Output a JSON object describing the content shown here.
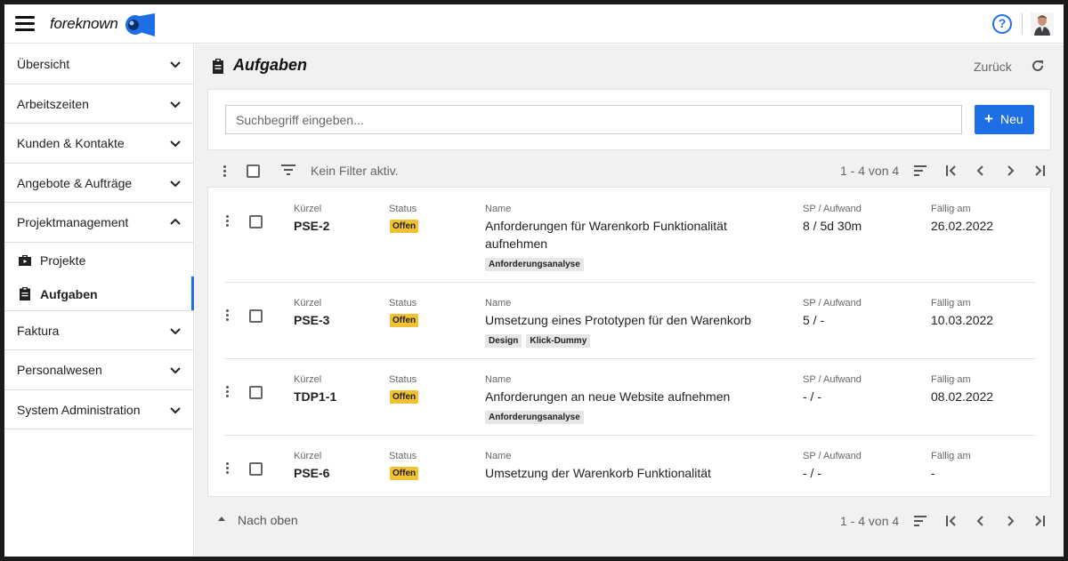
{
  "app": {
    "brand": "foreknown",
    "help_glyph": "?"
  },
  "sidebar": {
    "items": [
      {
        "label": "Übersicht",
        "icon": "chevron-down-icon"
      },
      {
        "label": "Arbeitszeiten",
        "icon": "chevron-down-icon"
      },
      {
        "label": "Kunden & Kontakte",
        "icon": "chevron-down-icon"
      },
      {
        "label": "Angebote & Aufträge",
        "icon": "chevron-down-icon"
      },
      {
        "label": "Projektmanagement",
        "icon": "chevron-up-icon"
      },
      {
        "label": "Faktura",
        "icon": "chevron-down-icon"
      },
      {
        "label": "Personalwesen",
        "icon": "chevron-down-icon"
      },
      {
        "label": "System Administration",
        "icon": "chevron-down-icon"
      }
    ],
    "sub_items": [
      {
        "label": "Projekte",
        "icon": "briefcase-icon"
      },
      {
        "label": "Aufgaben",
        "icon": "clipboard-icon",
        "active": true
      }
    ]
  },
  "page": {
    "title": "Aufgaben",
    "back_label": "Zurück"
  },
  "search": {
    "placeholder": "Suchbegriff eingeben...",
    "value": ""
  },
  "new_button": {
    "label": "Neu",
    "icon": "plus-icon"
  },
  "toolbar": {
    "filter_text": "Kein Filter aktiv.",
    "range_text": "1 - 4 von 4"
  },
  "columns": {
    "code": "Kürzel",
    "status": "Status",
    "name": "Name",
    "effort": "SP / Aufwand",
    "due": "Fällig am"
  },
  "tasks": [
    {
      "code": "PSE-2",
      "status": "Offen",
      "name_line1": "Anforderungen für Warenkorb Funktionalität",
      "name_line2": "aufnehmen",
      "tags": [
        "Anforderungsanalyse"
      ],
      "effort": "8 / 5d 30m",
      "due": "26.02.2022"
    },
    {
      "code": "PSE-3",
      "status": "Offen",
      "name_line1": "Umsetzung eines Prototypen für den Warenkorb",
      "name_line2": "",
      "tags": [
        "Design",
        "Klick-Dummy"
      ],
      "effort": "5 / -",
      "due": "10.03.2022"
    },
    {
      "code": "TDP1-1",
      "status": "Offen",
      "name_line1": "Anforderungen an neue Website aufnehmen",
      "name_line2": "",
      "tags": [
        "Anforderungsanalyse"
      ],
      "effort": "- / -",
      "due": "08.02.2022"
    },
    {
      "code": "PSE-6",
      "status": "Offen",
      "name_line1": "Umsetzung der Warenkorb Funktionalität",
      "name_line2": "",
      "tags": [],
      "effort": "- / -",
      "due": "-"
    }
  ],
  "footer": {
    "to_top_label": "Nach oben",
    "range_text": "1 - 4 von 4"
  },
  "colors": {
    "accent": "#1e6fe6",
    "status_badge": "#f2c232",
    "tag_bg": "#e6e6e6"
  }
}
